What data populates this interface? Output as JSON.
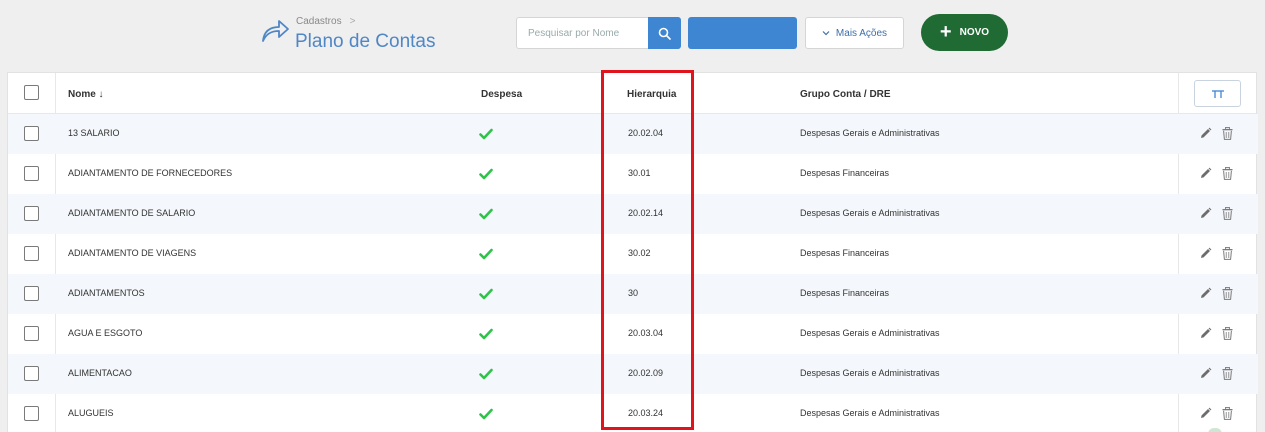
{
  "header": {
    "breadcrumb": "Cadastros",
    "breadcrumb_sep": ">",
    "title": "Plano de Contas",
    "search_placeholder": "Pesquisar por Nome",
    "more_actions_label": "Mais Ações",
    "new_label": "NOVO"
  },
  "table": {
    "columns": {
      "nome": "Nome ↓",
      "despesa": "Despesa",
      "hierarquia": "Hierarquia",
      "grupo": "Grupo Conta / DRE"
    },
    "rows": [
      {
        "nome": "13 SALARIO",
        "despesa": true,
        "hierarquia": "20.02.04",
        "grupo": "Despesas Gerais e Administrativas"
      },
      {
        "nome": "ADIANTAMENTO DE FORNECEDORES",
        "despesa": true,
        "hierarquia": "30.01",
        "grupo": "Despesas Financeiras"
      },
      {
        "nome": "ADIANTAMENTO DE SALARIO",
        "despesa": true,
        "hierarquia": "20.02.14",
        "grupo": "Despesas Gerais e Administrativas"
      },
      {
        "nome": "ADIANTAMENTO DE VIAGENS",
        "despesa": true,
        "hierarquia": "30.02",
        "grupo": "Despesas Financeiras"
      },
      {
        "nome": "ADIANTAMENTOS",
        "despesa": true,
        "hierarquia": "30",
        "grupo": "Despesas Financeiras"
      },
      {
        "nome": "AGUA E ESGOTO",
        "despesa": true,
        "hierarquia": "20.03.04",
        "grupo": "Despesas Gerais e Administrativas"
      },
      {
        "nome": "ALIMENTACAO",
        "despesa": true,
        "hierarquia": "20.02.09",
        "grupo": "Despesas Gerais e Administrativas"
      },
      {
        "nome": "ALUGUEIS",
        "despesa": true,
        "hierarquia": "20.03.24",
        "grupo": "Despesas Gerais e Administrativas"
      }
    ]
  },
  "icons": {
    "title": "share-forward-icon",
    "search": "search-icon",
    "more_actions": "chevron-down-icon",
    "new": "plus-icon",
    "columns": "column-settings-icon",
    "despesa": "check-icon",
    "edit": "pencil-icon",
    "delete": "trash-icon"
  },
  "colors": {
    "primary": "#3f86d2",
    "title": "#4f86c6",
    "new_button": "#1f6b33",
    "check": "#2ec44a",
    "highlight": "#e0141c",
    "row_stripe": "#f4f7fb"
  }
}
